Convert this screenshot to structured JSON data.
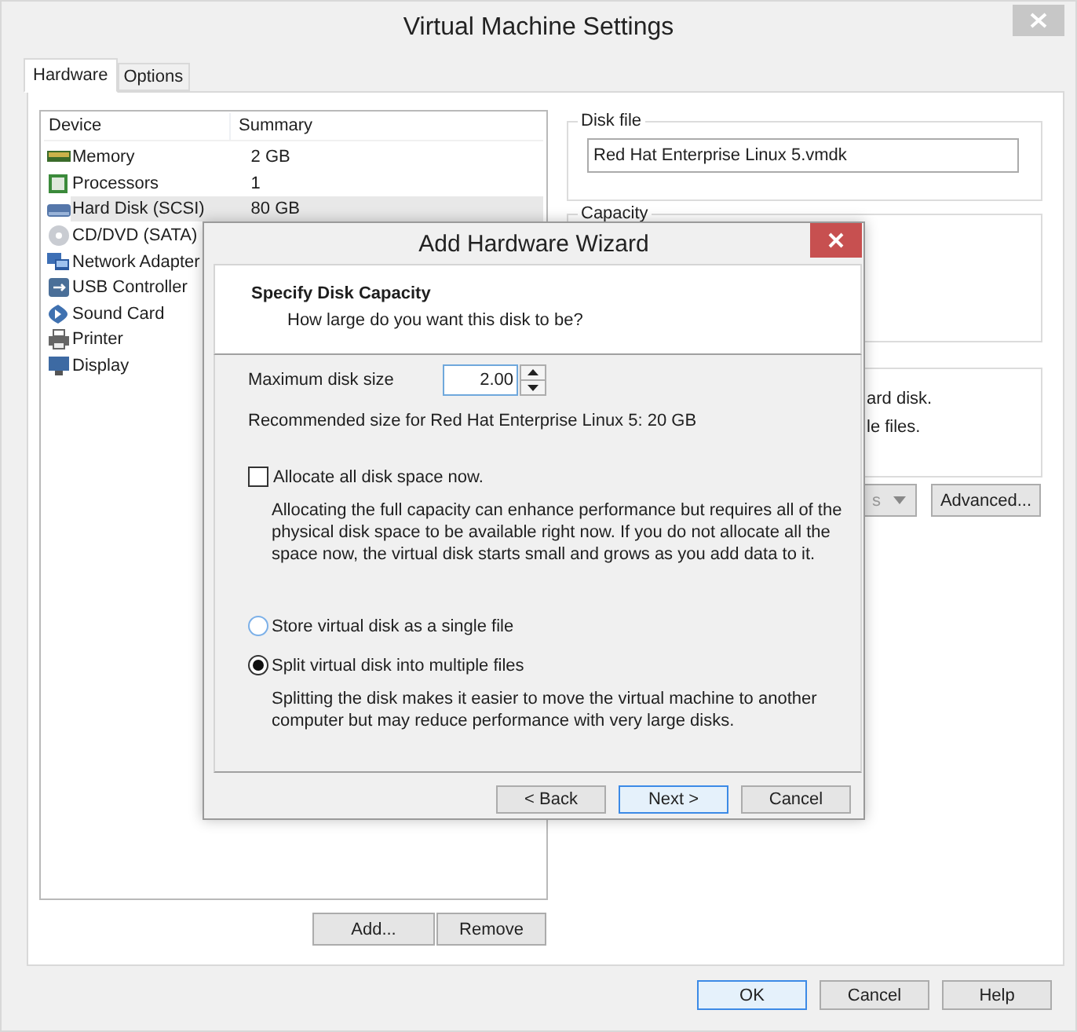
{
  "window": {
    "title": "Virtual Machine Settings"
  },
  "tabs": [
    {
      "label": "Hardware",
      "selected": true
    },
    {
      "label": "Options",
      "selected": false
    }
  ],
  "device_list": {
    "columns": [
      "Device",
      "Summary"
    ],
    "rows": [
      {
        "kind": "memory",
        "device": "Memory",
        "summary": "2 GB",
        "selected": false
      },
      {
        "kind": "processor",
        "device": "Processors",
        "summary": "1",
        "selected": false
      },
      {
        "kind": "disk",
        "device": "Hard Disk (SCSI)",
        "summary": "80 GB",
        "selected": true
      },
      {
        "kind": "cd",
        "device": "CD/DVD (SATA)",
        "summary": "",
        "selected": false
      },
      {
        "kind": "network",
        "device": "Network Adapter",
        "summary": "",
        "selected": false
      },
      {
        "kind": "usb",
        "device": "USB Controller",
        "summary": "",
        "selected": false
      },
      {
        "kind": "sound",
        "device": "Sound Card",
        "summary": "",
        "selected": false
      },
      {
        "kind": "printer",
        "device": "Printer",
        "summary": "",
        "selected": false
      },
      {
        "kind": "display",
        "device": "Display",
        "summary": "",
        "selected": false
      }
    ]
  },
  "list_buttons": [
    "Add...",
    "Remove"
  ],
  "disk_file": {
    "legend": "Disk file",
    "value": "Red Hat Enterprise Linux 5.vmdk"
  },
  "capacity": {
    "legend": "Capacity"
  },
  "info_lines": [
    "ard disk.",
    "le files."
  ],
  "utilities_button": {
    "label": "s"
  },
  "advanced_button": "Advanced...",
  "buttons": [
    {
      "label": "OK",
      "default": true
    },
    {
      "label": "Cancel",
      "default": false
    },
    {
      "label": "Help",
      "default": false
    }
  ],
  "dialog": {
    "title": "Add Hardware Wizard",
    "heading": "Specify Disk Capacity",
    "subheading": "How large do you want this disk to be?",
    "size_label": "Maximum disk size",
    "size_value": "2.00",
    "recommended": "Recommended size for Red Hat Enterprise Linux 5: 20 GB",
    "allocate": {
      "label": "Allocate all disk space now.",
      "checked": false,
      "description": "Allocating the full capacity can enhance performance but requires all of the physical disk space to be available right now. If you do not allocate all the space now, the virtual disk starts small and grows as you add data to it."
    },
    "options": [
      {
        "label": "Store virtual disk as a single file",
        "selected": false
      },
      {
        "label": "Split virtual disk into multiple files",
        "selected": true,
        "description": "Splitting the disk makes it easier to move the virtual machine to another computer but may reduce performance with very large disks."
      }
    ],
    "buttons": [
      {
        "label": "< Back",
        "default": false
      },
      {
        "label": "Next >",
        "default": true
      },
      {
        "label": "Cancel",
        "default": false
      }
    ]
  }
}
